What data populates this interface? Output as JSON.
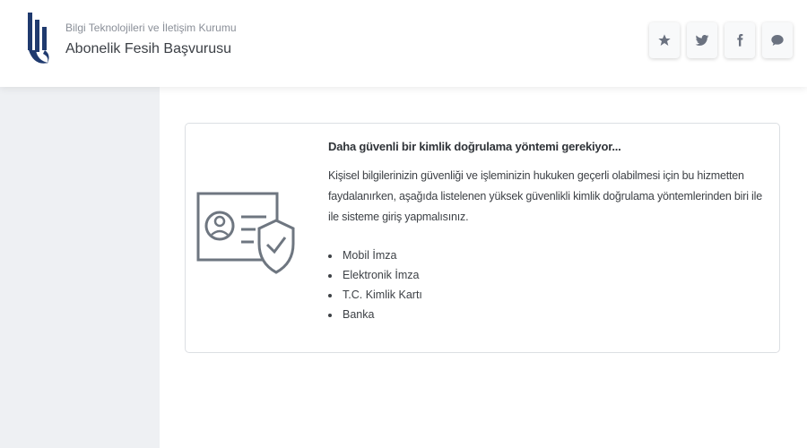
{
  "header": {
    "org_name": "Bilgi Teknolojileri ve İletişim Kurumu",
    "title": "Abonelik Fesih Başvurusu",
    "actions": [
      {
        "icon": "star-icon"
      },
      {
        "icon": "twitter-icon"
      },
      {
        "icon": "facebook-icon"
      },
      {
        "icon": "chat-icon"
      }
    ]
  },
  "notice": {
    "heading": "Daha güvenli bir kimlik doğrulama yöntemi gerekiyor...",
    "description": "Kişisel bilgilerinizin güvenliği ve işleminizin hukuken geçerli olabilmesi için bu hizmetten faydalanırken, aşağıda listelenen yüksek güvenlikli kimlik doğrulama yöntemlerinden biri ile ile sisteme giriş yapmalısınız.",
    "methods": [
      "Mobil İmza",
      "Elektronik İmza",
      "T.C. Kimlik Kartı",
      "Banka"
    ]
  },
  "colors": {
    "accent": "#1f3a6e",
    "sidebar_bg": "#eef0f3",
    "icon_gray": "#6b7280"
  }
}
